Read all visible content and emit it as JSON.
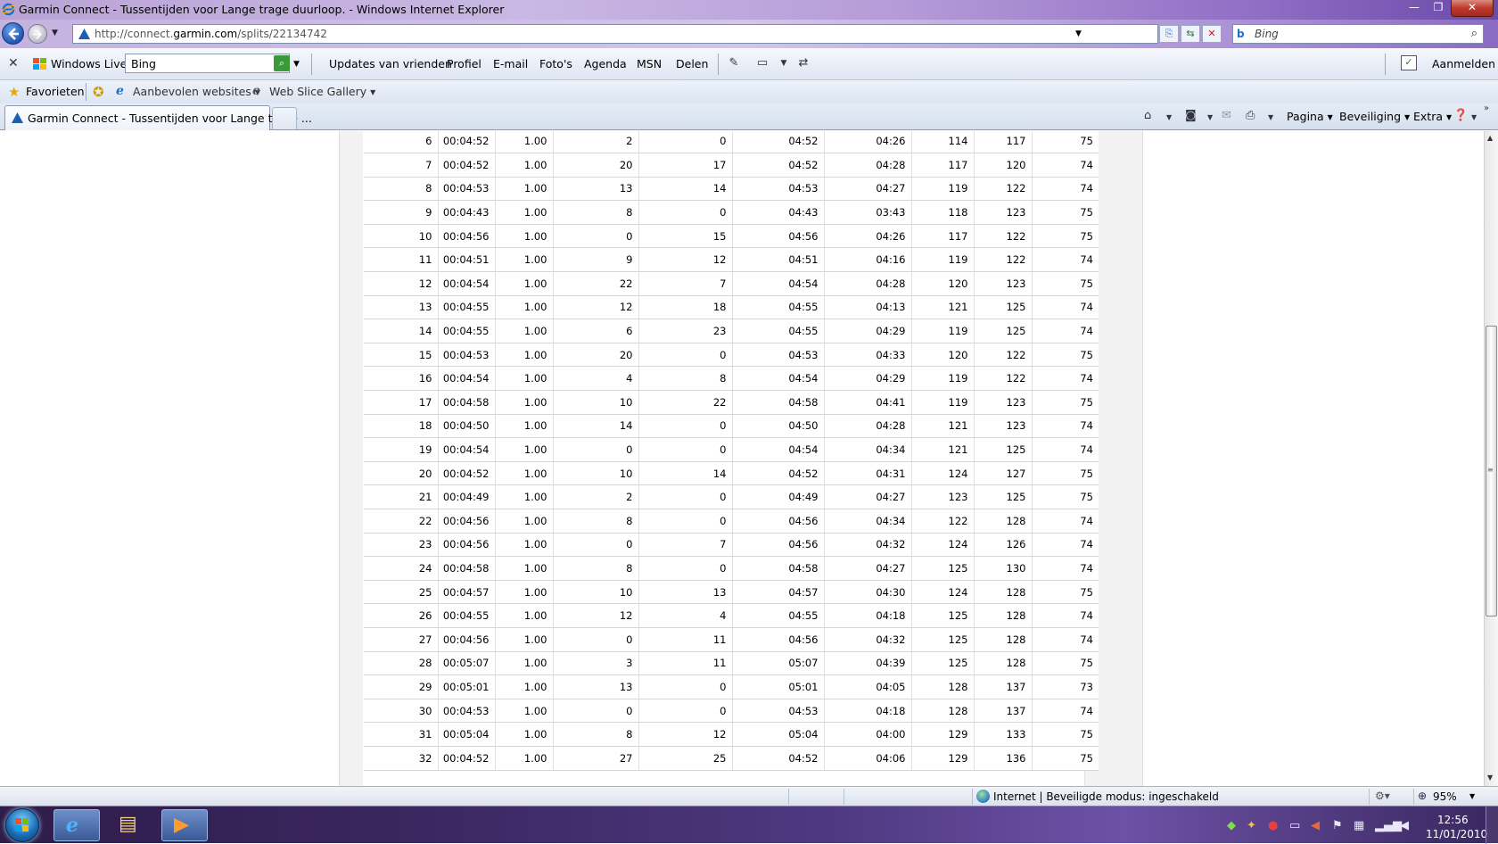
{
  "window": {
    "title": "Garmin Connect - Tussentijden voor Lange trage duurloop. - Windows Internet Explorer",
    "minimize_label": "—",
    "maximize_label": "❐",
    "close_label": "✕"
  },
  "address": {
    "url_prefix": "http://connect.",
    "url_domain": "garmin.com",
    "url_path": "/splits/22134742",
    "search_placeholder": "Bing"
  },
  "live_toolbar": {
    "brand": "Windows Live",
    "search_value": "Bing",
    "links": [
      "Updates van vrienden",
      "Profiel",
      "E-mail",
      "Foto's",
      "Agenda",
      "MSN",
      "Delen"
    ],
    "signin": "Aanmelden"
  },
  "favorites": {
    "label": "Favorieten",
    "items": [
      "Aanbevolen websites",
      "Web Slice Gallery"
    ]
  },
  "tabs": [
    {
      "label": "Garmin Connect - Tussentijden voor Lange trage ..."
    }
  ],
  "commands": {
    "page": "Pagina",
    "security": "Beveiliging",
    "extra": "Extra"
  },
  "splits": {
    "rows": [
      [
        "6",
        "00:04:52",
        "1.00",
        "2",
        "0",
        "04:52",
        "04:26",
        "114",
        "117",
        "75"
      ],
      [
        "7",
        "00:04:52",
        "1.00",
        "20",
        "17",
        "04:52",
        "04:28",
        "117",
        "120",
        "74"
      ],
      [
        "8",
        "00:04:53",
        "1.00",
        "13",
        "14",
        "04:53",
        "04:27",
        "119",
        "122",
        "74"
      ],
      [
        "9",
        "00:04:43",
        "1.00",
        "8",
        "0",
        "04:43",
        "03:43",
        "118",
        "123",
        "75"
      ],
      [
        "10",
        "00:04:56",
        "1.00",
        "0",
        "15",
        "04:56",
        "04:26",
        "117",
        "122",
        "75"
      ],
      [
        "11",
        "00:04:51",
        "1.00",
        "9",
        "12",
        "04:51",
        "04:16",
        "119",
        "122",
        "74"
      ],
      [
        "12",
        "00:04:54",
        "1.00",
        "22",
        "7",
        "04:54",
        "04:28",
        "120",
        "123",
        "75"
      ],
      [
        "13",
        "00:04:55",
        "1.00",
        "12",
        "18",
        "04:55",
        "04:13",
        "121",
        "125",
        "74"
      ],
      [
        "14",
        "00:04:55",
        "1.00",
        "6",
        "23",
        "04:55",
        "04:29",
        "119",
        "125",
        "74"
      ],
      [
        "15",
        "00:04:53",
        "1.00",
        "20",
        "0",
        "04:53",
        "04:33",
        "120",
        "122",
        "75"
      ],
      [
        "16",
        "00:04:54",
        "1.00",
        "4",
        "8",
        "04:54",
        "04:29",
        "119",
        "122",
        "74"
      ],
      [
        "17",
        "00:04:58",
        "1.00",
        "10",
        "22",
        "04:58",
        "04:41",
        "119",
        "123",
        "75"
      ],
      [
        "18",
        "00:04:50",
        "1.00",
        "14",
        "0",
        "04:50",
        "04:28",
        "121",
        "123",
        "74"
      ],
      [
        "19",
        "00:04:54",
        "1.00",
        "0",
        "0",
        "04:54",
        "04:34",
        "121",
        "125",
        "74"
      ],
      [
        "20",
        "00:04:52",
        "1.00",
        "10",
        "14",
        "04:52",
        "04:31",
        "124",
        "127",
        "75"
      ],
      [
        "21",
        "00:04:49",
        "1.00",
        "2",
        "0",
        "04:49",
        "04:27",
        "123",
        "125",
        "75"
      ],
      [
        "22",
        "00:04:56",
        "1.00",
        "8",
        "0",
        "04:56",
        "04:34",
        "122",
        "128",
        "74"
      ],
      [
        "23",
        "00:04:56",
        "1.00",
        "0",
        "7",
        "04:56",
        "04:32",
        "124",
        "126",
        "74"
      ],
      [
        "24",
        "00:04:58",
        "1.00",
        "8",
        "0",
        "04:58",
        "04:27",
        "125",
        "130",
        "74"
      ],
      [
        "25",
        "00:04:57",
        "1.00",
        "10",
        "13",
        "04:57",
        "04:30",
        "124",
        "128",
        "75"
      ],
      [
        "26",
        "00:04:55",
        "1.00",
        "12",
        "4",
        "04:55",
        "04:18",
        "125",
        "128",
        "74"
      ],
      [
        "27",
        "00:04:56",
        "1.00",
        "0",
        "11",
        "04:56",
        "04:32",
        "125",
        "128",
        "74"
      ],
      [
        "28",
        "00:05:07",
        "1.00",
        "3",
        "11",
        "05:07",
        "04:39",
        "125",
        "128",
        "75"
      ],
      [
        "29",
        "00:05:01",
        "1.00",
        "13",
        "0",
        "05:01",
        "04:05",
        "128",
        "137",
        "73"
      ],
      [
        "30",
        "00:04:53",
        "1.00",
        "0",
        "0",
        "04:53",
        "04:18",
        "128",
        "137",
        "74"
      ],
      [
        "31",
        "00:05:04",
        "1.00",
        "8",
        "12",
        "05:04",
        "04:00",
        "129",
        "133",
        "75"
      ],
      [
        "32",
        "00:04:52",
        "1.00",
        "27",
        "25",
        "04:52",
        "04:06",
        "129",
        "136",
        "75"
      ]
    ]
  },
  "status": {
    "zone": "Internet | Beveiligde modus: ingeschakeld",
    "zoom": "95%"
  },
  "taskbar": {
    "time": "12:56",
    "date": "11/01/2010"
  },
  "colors": {
    "titlebar_accent": "#8e6cc4",
    "taskbar_accent": "#3c2862"
  }
}
